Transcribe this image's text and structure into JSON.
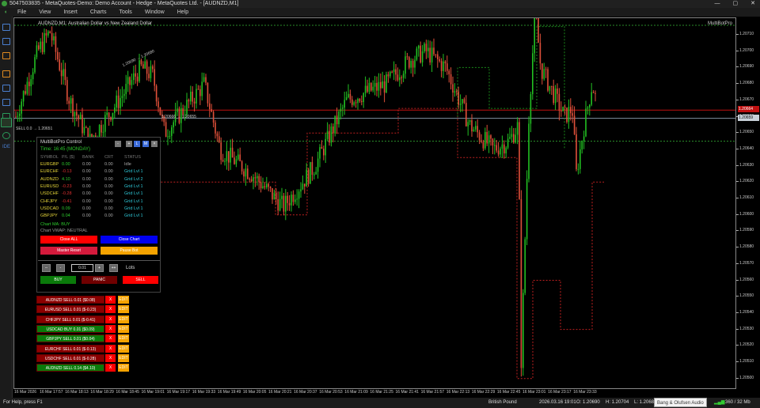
{
  "window": {
    "title": "5047503835 - MetaQuotes-Demo: Demo Account - Hedge - MetaQuotes Ltd. - [AUDNZD,M1]",
    "controls": [
      "—",
      "▢",
      "✕"
    ]
  },
  "menu": [
    "File",
    "View",
    "Insert",
    "Charts",
    "Tools",
    "Window",
    "Help"
  ],
  "chart": {
    "symbol_title": "AUDNZD,M1:  Australian Dollar vs New Zealand Dollar",
    "ea_name": "MultiBotPro",
    "sell_label": "SELL 0.0 → 1.20651",
    "line_label_1": "1.20666 → 1.20655",
    "trend_label": "1.20690 → 1.20680",
    "price_labels": [
      "1.20710",
      "1.20700",
      "1.20690",
      "1.20680",
      "1.20670",
      "1.20660",
      "1.20650",
      "1.20640",
      "1.20630",
      "1.20620",
      "1.20610",
      "1.20600",
      "1.20590",
      "1.20580",
      "1.20570",
      "1.20560",
      "1.20550",
      "1.20540",
      "1.20530",
      "1.20520",
      "1.20510",
      "1.20500"
    ],
    "ask_tag": "1.20664",
    "bid_tag": "1.20659",
    "time_labels": [
      "16 Mar 2026",
      "16 Mar 17:57",
      "16 Mar 18:13",
      "16 Mar 18:29",
      "16 Mar 18:45",
      "16 Mar 19:01",
      "16 Mar 19:17",
      "16 Mar 19:33",
      "16 Mar 19:49",
      "16 Mar 20:05",
      "16 Mar 20:21",
      "16 Mar 20:37",
      "16 Mar 20:53",
      "16 Mar 21:09",
      "16 Mar 21:25",
      "16 Mar 21:41",
      "16 Mar 21:57",
      "16 Mar 22:13",
      "16 Mar 22:29",
      "16 Mar 22:45",
      "16 Mar 23:01",
      "16 Mar 23:17",
      "16 Mar 23:33"
    ],
    "colors": {
      "bull": "#22c022",
      "bear": "#e0503a",
      "ask": "#c01010",
      "bid": "#8090a0"
    }
  },
  "panel": {
    "title": "MultiBotPro Control",
    "time": "Time: 16:45 (MONDAY)",
    "buttons": [
      "-",
      "+",
      "L",
      "M",
      "×"
    ],
    "headers": [
      "SYMBOL",
      "P/L ($)",
      "BANK",
      "CRT",
      "STATUS"
    ],
    "rows": [
      {
        "symbol": "EURGBP",
        "pl": "0.00",
        "bank": "0.00",
        "crt": "0.00",
        "status": "Idle",
        "sign": "pos"
      },
      {
        "symbol": "EURCHF",
        "pl": "-0.13",
        "bank": "0.00",
        "crt": "0.00",
        "status": "Grid Lvl 1",
        "sign": "neg"
      },
      {
        "symbol": "AUDNZD",
        "pl": "4.10",
        "bank": "0.00",
        "crt": "0.00",
        "status": "Grid Lvl 2",
        "sign": "pos"
      },
      {
        "symbol": "EURUSD",
        "pl": "-0.23",
        "bank": "0.00",
        "crt": "0.00",
        "status": "Grid Lvl 1",
        "sign": "neg"
      },
      {
        "symbol": "USDCHF",
        "pl": "-0.28",
        "bank": "0.00",
        "crt": "0.00",
        "status": "Grid Lvl 1",
        "sign": "neg"
      },
      {
        "symbol": "CHFJPY",
        "pl": "-0.41",
        "bank": "0.00",
        "crt": "0.00",
        "status": "Grid Lvl 1",
        "sign": "neg"
      },
      {
        "symbol": "USDCAD",
        "pl": "0.09",
        "bank": "0.00",
        "crt": "0.00",
        "status": "Grid Lvl 1",
        "sign": "pos"
      },
      {
        "symbol": "GBPJPY",
        "pl": "0.04",
        "bank": "0.00",
        "crt": "0.00",
        "status": "Grid Lvl 1",
        "sign": "pos"
      }
    ],
    "chart_ma": "Chart MA: BUY",
    "chart_vwap": "Chart VWAP: NEUTRAL",
    "close_all": "Close ALL",
    "close_chart": "Close Chart",
    "master_reset": "Master Reset",
    "pause_bot": "Pause Bot",
    "lot_minus2": "--",
    "lot_minus": "-",
    "lot_value": "0.01",
    "lot_plus": "+",
    "lot_plus2": "++",
    "lots_label": "Lots",
    "buy": "BUY",
    "panic": "PANIC",
    "sell": "SELL"
  },
  "positions": [
    {
      "label": "AUDNZD SELL 0.01 ($0.08)",
      "color": "#8b0000"
    },
    {
      "label": "EURUSD SELL 0.01 ($-0.23)",
      "color": "#8b0000"
    },
    {
      "label": "CHFJPY SELL 0.01 ($-0.41)",
      "color": "#8b0000"
    },
    {
      "label": "USDCAD BUY 0.01 ($0.09)",
      "color": "#0a7a0a"
    },
    {
      "label": "GBPJPY SELL 0.01 ($0.04)",
      "color": "#0a7a0a"
    },
    {
      "label": "EURCHF SELL 0.01 ($-0.13)",
      "color": "#8b0000"
    },
    {
      "label": "USDCHF SELL 0.01 ($-0.28)",
      "color": "#8b0000"
    },
    {
      "label": "AUDNZD SELL 0.14 ($4.10)",
      "color": "#0a7a0a"
    }
  ],
  "position_close": "X",
  "position_edit": "EDIT",
  "status": {
    "help": "For Help, press F1",
    "profile": "British Pound",
    "datetime": "2026.03.16 19:01",
    "open": "O: 1.20690",
    "high": "H: 1.20704",
    "low": "L: 1.20683",
    "tooltip": "Bang & Olufsen Audio",
    "memory": "360 / 32 Mb"
  }
}
